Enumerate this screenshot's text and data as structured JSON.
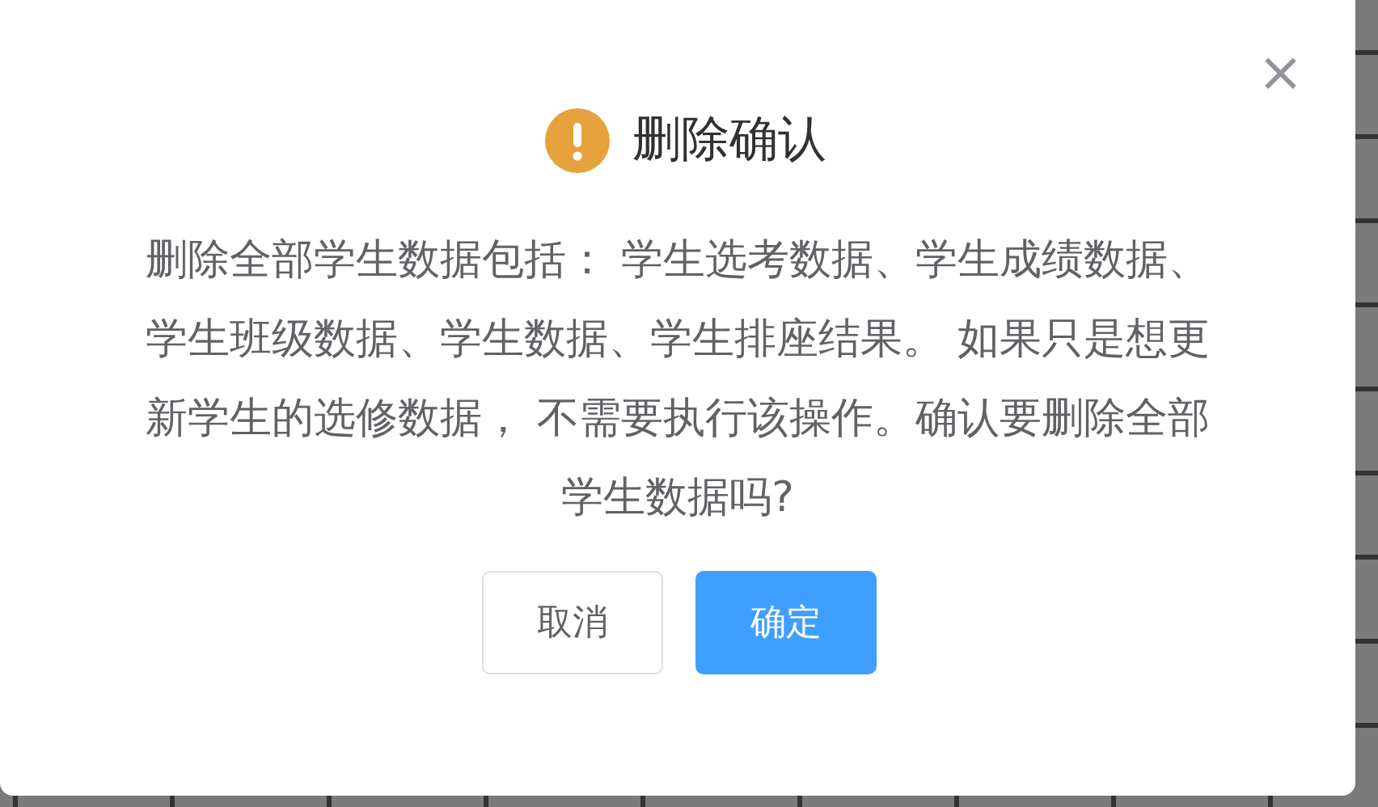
{
  "dialog": {
    "title": "删除确认",
    "close": "×",
    "message": "删除全部学生数据包括： 学生选考数据、学生成绩数据、学生班级数据、学生数据、学生排座结果。 如果只是想更新学生的选修数据， 不需要执行该操作。确认要删除全部学生数据吗?",
    "buttons": [
      {
        "label": "取消",
        "kind": "secondary"
      },
      {
        "label": "确定",
        "kind": "primary"
      }
    ]
  }
}
